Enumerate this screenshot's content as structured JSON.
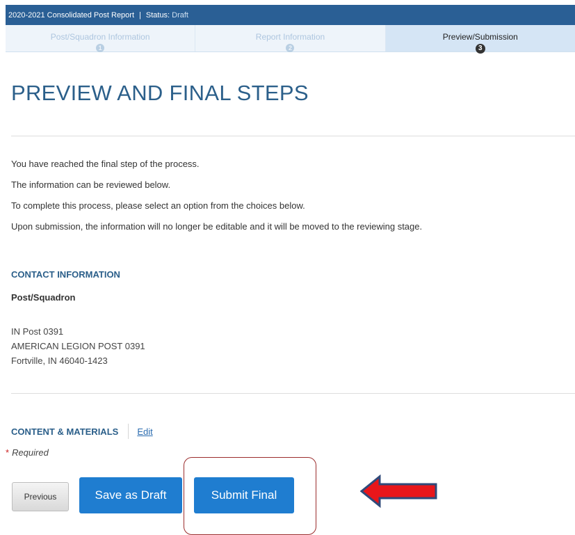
{
  "header": {
    "title": "2020-2021 Consolidated Post Report",
    "separator": "|",
    "status_label": "Status:",
    "status_value": "Draft"
  },
  "steps": [
    {
      "label": "Post/Squadron Information",
      "number": "1",
      "active": false
    },
    {
      "label": "Report Information",
      "number": "2",
      "active": false
    },
    {
      "label": "Preview/Submission",
      "number": "3",
      "active": true
    }
  ],
  "page_title": "PREVIEW AND FINAL STEPS",
  "intro": [
    "You have reached the final step of the process.",
    "The information can be reviewed below.",
    "To complete this process, please select an option from the choices below.",
    "Upon submission, the information will no longer be editable and it will be moved to the reviewing stage."
  ],
  "contact": {
    "heading": "CONTACT INFORMATION",
    "subheading": "Post/Squadron",
    "address_lines": [
      "IN Post 0391",
      "AMERICAN LEGION POST 0391",
      "Fortville, IN 46040-1423"
    ]
  },
  "content": {
    "heading": "CONTENT & MATERIALS",
    "edit_label": "Edit"
  },
  "required": {
    "star": "*",
    "text": "Required"
  },
  "buttons": {
    "previous": "Previous",
    "save_draft": "Save as Draft",
    "submit_final": "Submit Final"
  },
  "colors": {
    "header_bg": "#2a5f95",
    "accent_text": "#2b5f8a",
    "button_primary": "#1f7dd0",
    "highlight_border": "#9b2d2d",
    "arrow_fill": "#e8161b",
    "arrow_outline": "#2f4a7a"
  },
  "icons": {
    "annotation_arrow": "left-arrow-icon"
  }
}
